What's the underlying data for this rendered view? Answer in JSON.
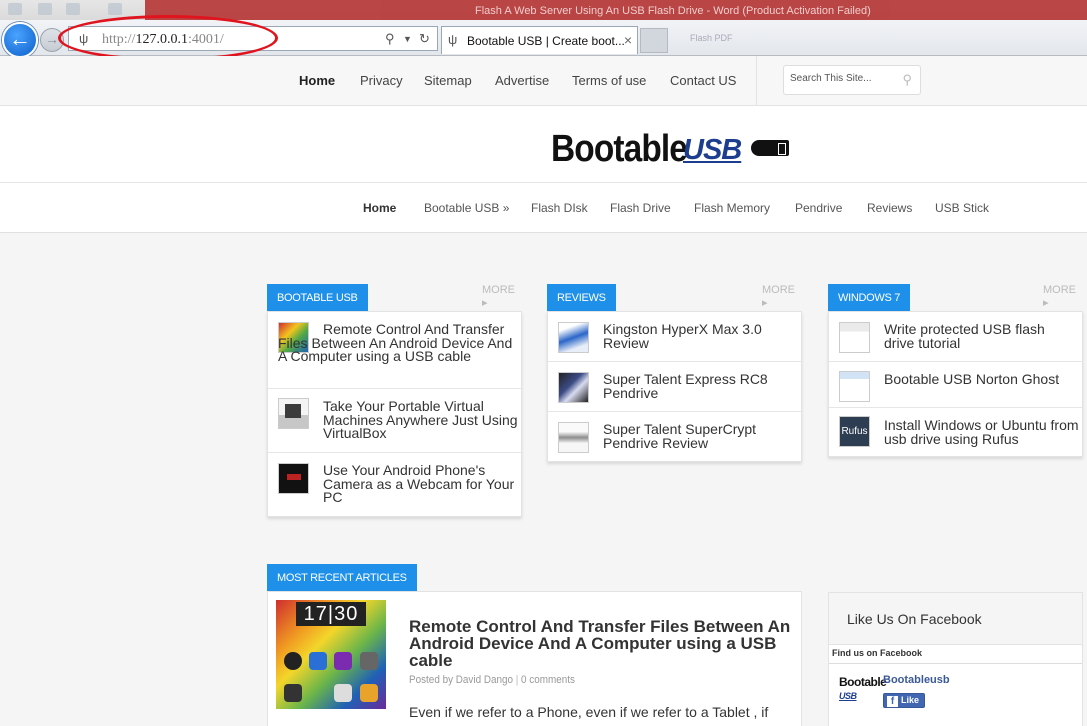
{
  "browser": {
    "window_title": "Flash A Web Server Using An USB Flash Drive - Word (Product Activation Failed)",
    "address": {
      "url_prefix": "http://",
      "url_host": "127.0.0.1",
      "url_suffix": ":4001/"
    },
    "tab": {
      "title": "Bootable USB | Create boot..."
    },
    "faded_tab": "Flash PDF"
  },
  "topnav": {
    "items": [
      "Home",
      "Privacy",
      "Sitemap",
      "Advertise",
      "Terms of use",
      "Contact US"
    ],
    "search_placeholder": "Search This Site..."
  },
  "logo": {
    "text": "Bootable",
    "accent": "USB",
    "plug_letter": "B"
  },
  "mainnav": {
    "items": [
      "Home",
      "Bootable USB »",
      "Flash DIsk",
      "Flash Drive",
      "Flash Memory",
      "Pendrive",
      "Reviews",
      "USB Stick"
    ]
  },
  "widgets": [
    {
      "title": "BOOTABLE USB",
      "more": "MORE",
      "posts": [
        "Remote Control And Transfer Files Between An Android Device And A Computer using a USB cable",
        "Take Your Portable Virtual Machines Anywhere Just Using VirtualBox",
        "Use Your Android Phone's Camera as a Webcam for Your PC"
      ]
    },
    {
      "title": "REVIEWS",
      "more": "MORE",
      "posts": [
        "Kingston HyperX Max 3.0 Review",
        "Super Talent Express RC8 Pendrive",
        "Super Talent SuperCrypt Pendrive Review"
      ]
    },
    {
      "title": "WINDOWS 7",
      "more": "MORE",
      "posts": [
        "Write protected USB flash drive tutorial",
        "Bootable USB Norton Ghost",
        "Install Windows or Ubuntu from usb drive using Rufus"
      ]
    }
  ],
  "thumb_labels": {
    "rufus": "Rufus"
  },
  "recent": {
    "title": "MOST RECENT ARTICLES",
    "clock_h": "17",
    "clock_m": "30",
    "heading": "Remote Control And Transfer Files Between An Android Device And A Computer using a USB cable",
    "author": "Posted by David Dango",
    "comments": "0 comments",
    "excerpt": "Even if we refer to a Phone, even if we refer to a Tablet , if"
  },
  "facebook": {
    "title": "Like Us On Facebook",
    "subtitle": "Find us on Facebook",
    "page_name": "Bootableusb",
    "like_label": "Like",
    "mini_logo": "Bootable",
    "mini_logo_accent": "USB"
  }
}
